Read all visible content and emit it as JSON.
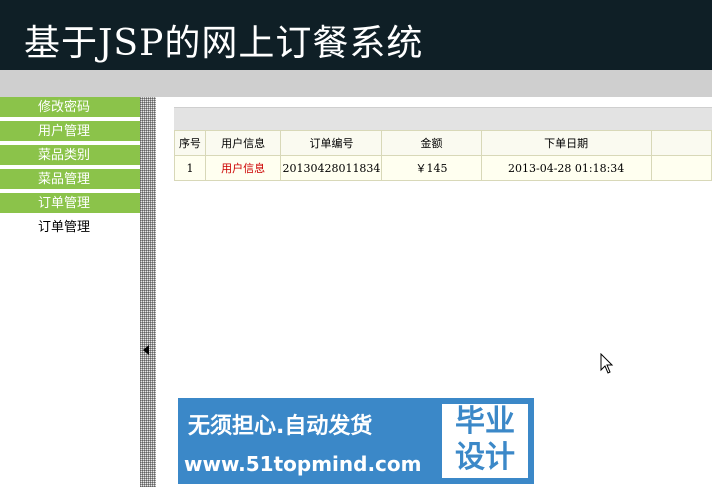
{
  "header": {
    "title": "基于JSP的网上订餐系统"
  },
  "sidebar": {
    "items": [
      {
        "label": "修改密码"
      },
      {
        "label": "用户管理"
      },
      {
        "label": "菜品类别"
      },
      {
        "label": "菜品管理"
      },
      {
        "label": "订单管理"
      },
      {
        "label": "订单管理"
      }
    ]
  },
  "table": {
    "headers": [
      "序号",
      "用户信息",
      "订单编号",
      "金额",
      "下单日期"
    ],
    "rows": [
      {
        "index": "1",
        "user": "用户信息",
        "order_no": "20130428011834",
        "amount": "￥145",
        "date": "2013-04-28 01:18:34"
      }
    ]
  },
  "ad": {
    "line1": "无须担心.自动发货",
    "line2": "www.51topmind.com",
    "badge_line1": "毕业",
    "badge_line2": "设计"
  },
  "colors": {
    "header_bg": "#0f1f26",
    "menu_green": "#8bc34a",
    "link_red": "#cc0000",
    "ad_blue": "#3b88c8"
  }
}
